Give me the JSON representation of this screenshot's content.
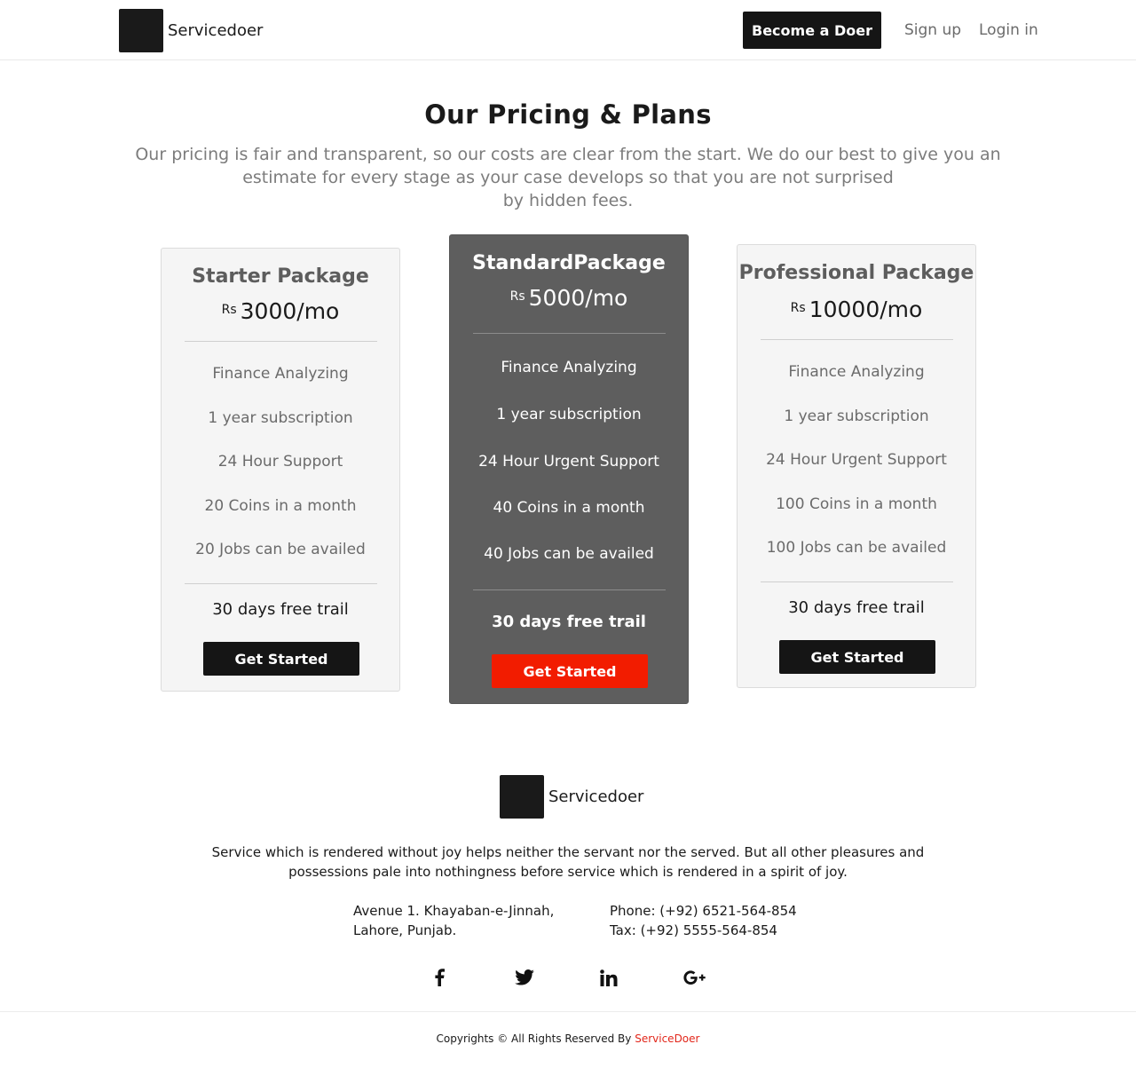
{
  "header": {
    "logo_text": "Servicedoer",
    "become_doer_label": "Become a Doer",
    "signup_label": "Sign up",
    "login_label": "Login in"
  },
  "hero": {
    "title": "Our Pricing & Plans",
    "subtitle_lines": [
      "Our pricing is fair and transparent, so our costs are clear from the start. We do our best to give you an",
      "estimate for every stage as your case develops so that you are not surprised",
      "by hidden fees."
    ]
  },
  "plans": [
    {
      "name": "Starter Package",
      "currency": "Rs",
      "price": "3000/mo",
      "features": [
        "Finance Analyzing",
        "1 year subscription",
        "24 Hour Support",
        "20 Coins in a month",
        "20 Jobs can be availed"
      ],
      "trial": "30 days free trail",
      "cta": "Get Started"
    },
    {
      "name": "StandardPackage",
      "currency": "Rs",
      "price": "5000/mo",
      "features": [
        "Finance Analyzing",
        "1 year subscription",
        "24 Hour Urgent Support",
        "40 Coins in a month",
        "40 Jobs can be availed"
      ],
      "trial": "30 days free trail",
      "cta": "Get Started"
    },
    {
      "name": "Professional  Package",
      "currency": "Rs",
      "price": "10000/mo",
      "features": [
        "Finance Analyzing",
        "1 year subscription",
        "24 Hour Urgent Support",
        "100 Coins in a month",
        "100 Jobs can be availed"
      ],
      "trial": "30 days free trail",
      "cta": "Get Started"
    }
  ],
  "footer": {
    "logo_text": "Servicedoer",
    "quote_lines": [
      "Service which is rendered without joy helps neither the servant nor the served. But all other pleasures and",
      "possessions pale into nothingness before service which is rendered in a spirit of joy."
    ],
    "address_lines": [
      "Avenue 1. Khayaban-e-Jinnah,",
      "Lahore, Punjab."
    ],
    "phone": "Phone: (+92) 6521-564-854",
    "tax": "Tax: (+92) 5555-564-854",
    "social_icons": [
      "facebook-icon",
      "twitter-icon",
      "linkedin-icon",
      "google-plus-icon"
    ],
    "copyright_prefix": "Copyrights © All Rights Reserved By",
    "copyright_brand": "ServiceDoer"
  },
  "colors": {
    "accent_red": "#f21c00",
    "dark": "#151515",
    "featured_card": "#5e5e5e"
  }
}
